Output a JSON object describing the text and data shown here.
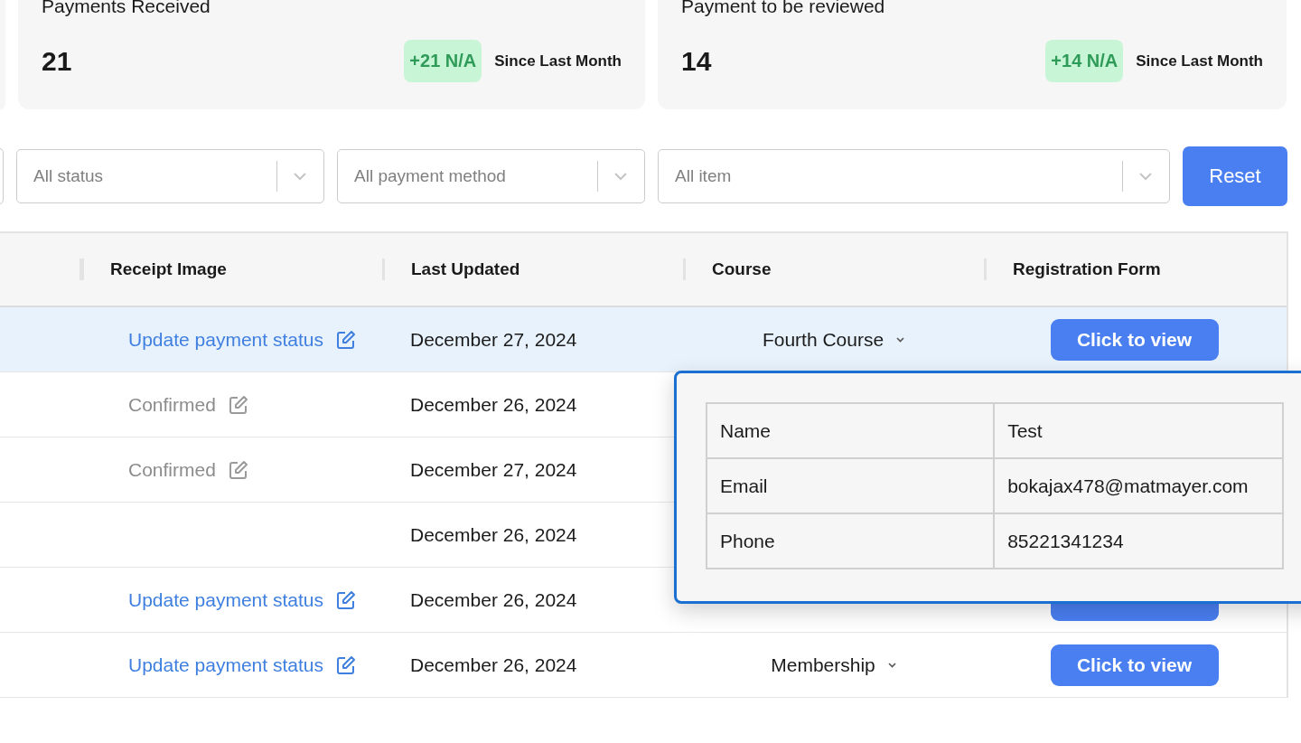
{
  "stat_cards": [
    {
      "title": "Payments Received",
      "value": "21",
      "change": "+21 N/A",
      "period": "Since Last Month"
    },
    {
      "title": "Payment to be reviewed",
      "value": "14",
      "change": "+14 N/A",
      "period": "Since Last Month"
    }
  ],
  "filters": [
    {
      "placeholder": "All status"
    },
    {
      "placeholder": "All payment method"
    },
    {
      "placeholder": "All item"
    }
  ],
  "reset_button": "Reset",
  "table": {
    "columns": [
      "Receipt Image",
      "Last Updated",
      "Course",
      "Registration Form"
    ],
    "rows": [
      {
        "selected": true,
        "receipt": {
          "kind": "update",
          "text": "Update payment status"
        },
        "last_updated": "December 27, 2024",
        "course": "Fourth Course",
        "registration": "Click to view"
      },
      {
        "selected": false,
        "receipt": {
          "kind": "confirmed",
          "text": "Confirmed"
        },
        "last_updated": "December 26, 2024"
      },
      {
        "selected": false,
        "receipt": {
          "kind": "confirmed",
          "text": "Confirmed"
        },
        "last_updated": "December 27, 2024"
      },
      {
        "selected": false,
        "last_updated": "December 26, 2024"
      },
      {
        "selected": false,
        "receipt": {
          "kind": "update",
          "text": "Update payment status"
        },
        "last_updated": "December 26, 2024",
        "registration_covered": true
      },
      {
        "selected": false,
        "receipt": {
          "kind": "update",
          "text": "Update payment status"
        },
        "last_updated": "December 26, 2024",
        "course": "Membership",
        "registration": "Click to view"
      }
    ]
  },
  "popover": {
    "rows": [
      {
        "label": "Name",
        "value": "Test"
      },
      {
        "label": "Email",
        "value": "bokajax478@matmayer.com"
      },
      {
        "label": "Phone",
        "value": "85221341234"
      }
    ]
  }
}
